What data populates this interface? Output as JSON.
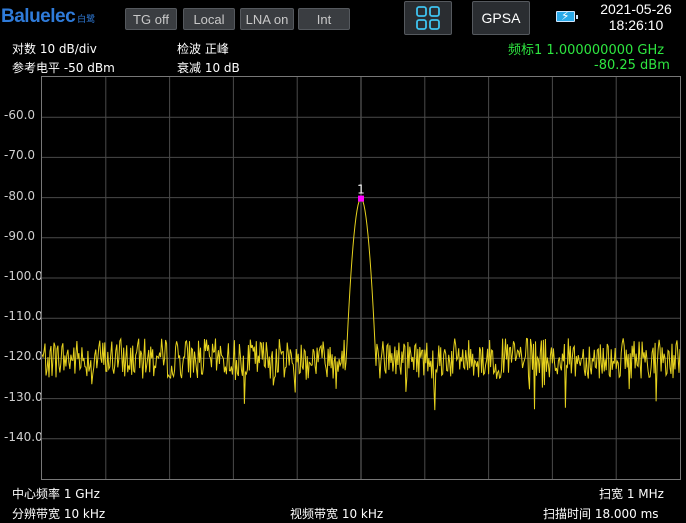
{
  "header": {
    "brand": "Baluelec",
    "brand_sub": "白鹭",
    "buttons": [
      "TG off",
      "Local",
      "LNA on",
      "Int"
    ],
    "mode_label": "GPSA",
    "date": "2021-05-26",
    "time": "18:26:10"
  },
  "settings": {
    "scale": "对数 10 dB/div",
    "ref_level": "参考电平 -50 dBm",
    "detector": "检波 正峰",
    "attenuation": "衰减 10 dB"
  },
  "marker": {
    "number": "1",
    "label": "频标1",
    "frequency": "1.000000000 GHz",
    "amplitude": "-80.25 dBm"
  },
  "footer": {
    "center_freq": "中心频率 1 GHz",
    "span": "扫宽 1 MHz",
    "rbw": "分辨带宽 10 kHz",
    "vbw": "视频带宽 10 kHz",
    "sweep_time": "扫描时间 18.000 ms"
  },
  "colors": {
    "trace": "#e6d21e",
    "marker": "#ff00ff",
    "marker_text": "#2ee640",
    "grid": "#4a4a4a",
    "accent": "#2f7bd9"
  },
  "chart_data": {
    "type": "line",
    "x_unit": "GHz",
    "xlim": [
      0.9995,
      1.0005
    ],
    "ylim": [
      -150,
      -50
    ],
    "y_ticks": [
      "-60.0",
      "-70.0",
      "-80.0",
      "-90.0",
      "-100.0",
      "-110.0",
      "-120.0",
      "-130.0",
      "-140.0"
    ],
    "grid": true,
    "peak": {
      "x": 1.0,
      "y": -80.25
    },
    "noise_floor_approx": -120
  }
}
